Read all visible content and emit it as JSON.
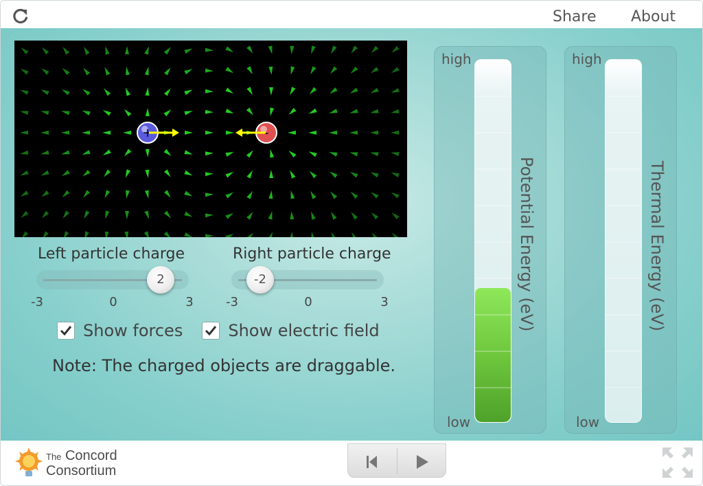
{
  "topbar": {
    "share_label": "Share",
    "about_label": "About"
  },
  "field": {
    "left_particle": {
      "sign": "+",
      "color": "#5a5adf"
    },
    "right_particle": {
      "sign": "-",
      "color": "#e05050"
    },
    "field_color": "#22cc22",
    "force_color": "#ffff00"
  },
  "left_slider": {
    "label": "Left particle charge",
    "value": "2",
    "min": "-3",
    "mid": "0",
    "max": "3"
  },
  "right_slider": {
    "label": "Right particle charge",
    "value": "-2",
    "min": "-3",
    "mid": "0",
    "max": "3"
  },
  "checkboxes": {
    "show_forces": "Show forces",
    "show_field": "Show electric field"
  },
  "note": "Note: The charged objects are draggable.",
  "potential": {
    "label": "Potential Energy (eV)",
    "high": "high",
    "low": "low",
    "level": 0.37
  },
  "thermal": {
    "label": "Thermal Energy (eV)",
    "high": "high",
    "low": "low",
    "level": 0
  },
  "brand": {
    "line1_small": "The",
    "line1": "Concord",
    "line2": "Consortium"
  }
}
